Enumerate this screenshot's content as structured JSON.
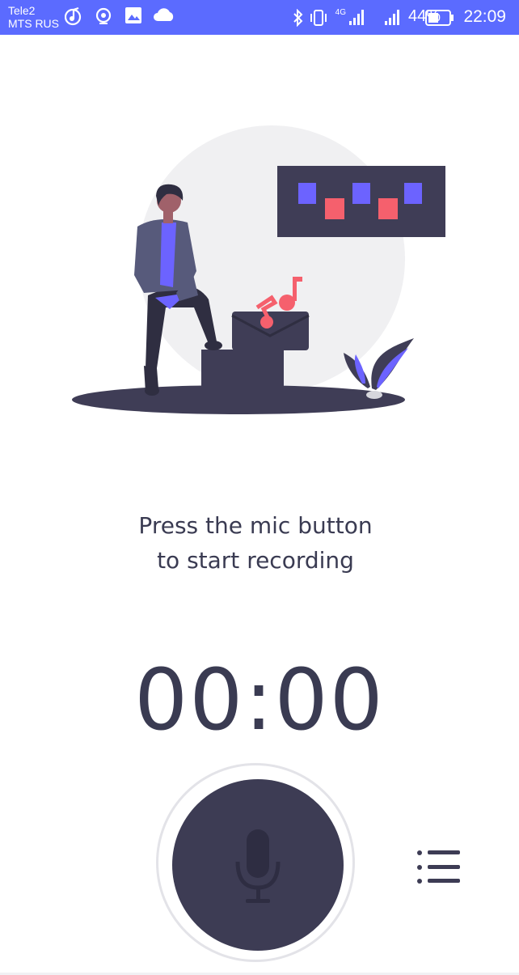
{
  "status_bar": {
    "carrier_1": "Tele2",
    "carrier_2": "MTS RUS",
    "network_label": "4G",
    "battery_percent": "44%",
    "time": "22:09",
    "icons_left": [
      "music-note-icon",
      "radio-icon",
      "image-icon",
      "cloud-icon"
    ],
    "icons_right": [
      "bluetooth-icon",
      "vibrate-icon",
      "signal-4g-icon",
      "signal-icon",
      "battery-icon"
    ],
    "background_color": "#5b6bff"
  },
  "illustration": {
    "description_icons": [
      "person-icon",
      "music-note-icon",
      "envelope-icon",
      "plant-icon",
      "sticky-notes-board-icon"
    ],
    "accent_color": "#6c63ff",
    "pink_color": "#f5606d",
    "dark_color": "#3f3d56"
  },
  "prompt": {
    "line_1": "Press the mic button",
    "line_2": "to start recording"
  },
  "timer": {
    "value": "00:00"
  },
  "controls": {
    "mic_icon": "microphone-icon",
    "list_icon": "list-icon",
    "button_color": "#3d3c54"
  }
}
